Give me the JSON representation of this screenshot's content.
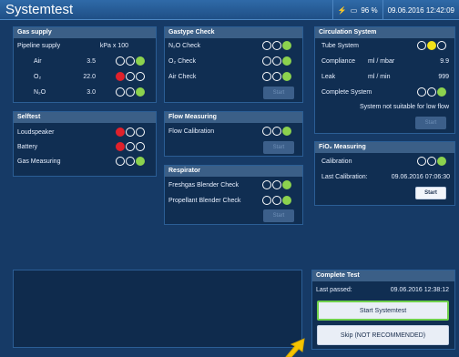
{
  "app": {
    "title": "Systemtest"
  },
  "status": {
    "battery": "96 %",
    "datetime": "09.06.2016 12:42:09"
  },
  "gas_supply": {
    "header": "Gas supply",
    "pipeline_label": "Pipeline supply",
    "unit": "kPa x 100",
    "rows": [
      {
        "label": "Air",
        "value": "3.5",
        "state": [
          "empty",
          "empty",
          "green"
        ]
      },
      {
        "label": "O₂",
        "value": "22.0",
        "state": [
          "red",
          "empty",
          "empty"
        ]
      },
      {
        "label": "N₂O",
        "value": "3.0",
        "state": [
          "empty",
          "empty",
          "green"
        ]
      }
    ]
  },
  "selftest": {
    "header": "Selftest",
    "rows": [
      {
        "label": "Loudspeaker",
        "state": [
          "red",
          "empty",
          "empty"
        ]
      },
      {
        "label": "Battery",
        "state": [
          "red",
          "empty",
          "empty"
        ]
      },
      {
        "label": "Gas Measuring",
        "state": [
          "empty",
          "empty",
          "green"
        ]
      }
    ]
  },
  "gastype_check": {
    "header": "Gastype Check",
    "rows": [
      {
        "label": "N₂O Check",
        "state": [
          "empty",
          "empty",
          "green"
        ]
      },
      {
        "label": "O₂ Check",
        "state": [
          "empty",
          "empty",
          "green"
        ]
      },
      {
        "label": "Air Check",
        "state": [
          "empty",
          "empty",
          "green"
        ]
      }
    ],
    "start_label": "Start"
  },
  "flow_measuring": {
    "header": "Flow Measuring",
    "rows": [
      {
        "label": "Flow Calibration",
        "state": [
          "empty",
          "empty",
          "green"
        ]
      }
    ],
    "start_label": "Start"
  },
  "respirator": {
    "header": "Respirator",
    "rows": [
      {
        "label": "Freshgas Blender Check",
        "state": [
          "empty",
          "empty",
          "green"
        ]
      },
      {
        "label": "Propellant Blender Check",
        "state": [
          "empty",
          "empty",
          "green"
        ]
      }
    ],
    "start_label": "Start"
  },
  "circulation": {
    "header": "Circulation System",
    "tube_label": "Tube System",
    "tube_state": [
      "empty",
      "yellow",
      "empty"
    ],
    "compliance_label": "Compliance",
    "compliance_unit": "ml / mbar",
    "compliance_value": "9.9",
    "leak_label": "Leak",
    "leak_unit": "ml / min",
    "leak_value": "999",
    "complete_label": "Complete System",
    "complete_state": [
      "empty",
      "empty",
      "green"
    ],
    "note": "System not suitable for low flow",
    "start_label": "Start"
  },
  "fio2": {
    "header": "FiO₂ Measuring",
    "calibration_label": "Calibration",
    "calibration_state": [
      "empty",
      "empty",
      "green"
    ],
    "last_label": "Last Calibration:",
    "last_value": "09.06.2016  07:06:30",
    "start_label": "Start"
  },
  "complete_test": {
    "header": "Complete Test",
    "last_passed_label": "Last passed:",
    "last_passed_value": "09.06.2016  12:38:12",
    "start_label": "Start Systemtest",
    "skip_label": "Skip (NOT RECOMMENDED)"
  },
  "colors": {
    "red": "#e0212b",
    "green": "#8cd24e",
    "yellow": "#f3e21a",
    "accent": "#6fd04b"
  }
}
